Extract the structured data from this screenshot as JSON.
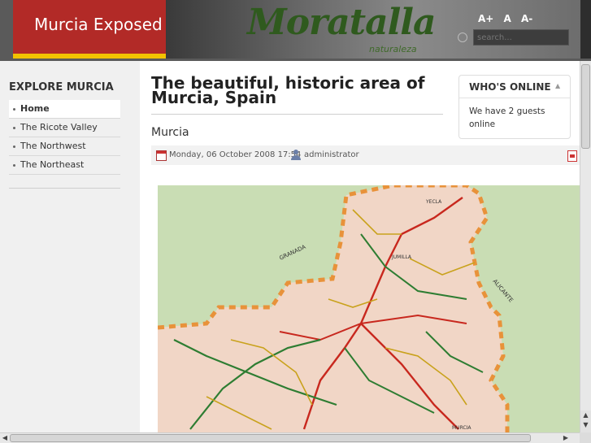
{
  "header": {
    "site_title": "Murcia Exposed",
    "banner_logo_text": "Moratalla",
    "banner_sub_text": "naturaleza",
    "font_tools": [
      "A+",
      "A",
      "A-"
    ],
    "search_placeholder": "search..."
  },
  "sidebar": {
    "title": "EXPLORE MURCIA",
    "items": [
      {
        "label": "Home",
        "active": true
      },
      {
        "label": "The Ricote Valley"
      },
      {
        "label": "The Northwest"
      },
      {
        "label": "The Northeast"
      }
    ]
  },
  "main": {
    "page_title": "The beautiful, historic area of Murcia, Spain",
    "article_title": "Murcia",
    "meta_date": "Monday, 06 October 2008 17:54",
    "meta_author": "administrator"
  },
  "whos_online": {
    "title": "WHO'S ONLINE",
    "toggle": "▲",
    "text": "We have 2 guests online"
  },
  "map": {
    "labels": [
      "YECLA",
      "GRANADA",
      "JUMILLA",
      "ALICANTE",
      "MURCIA"
    ],
    "colors": {
      "land": "#f1d6c6",
      "outside": "#c9ddb4",
      "border": "#e8923a",
      "road_red": "#c8281e",
      "road_green": "#2e7d32",
      "road_yellow": "#c9a21c"
    }
  },
  "scrollbars": {
    "up": "▲",
    "down": "▼",
    "left": "◀",
    "right": "▶"
  }
}
